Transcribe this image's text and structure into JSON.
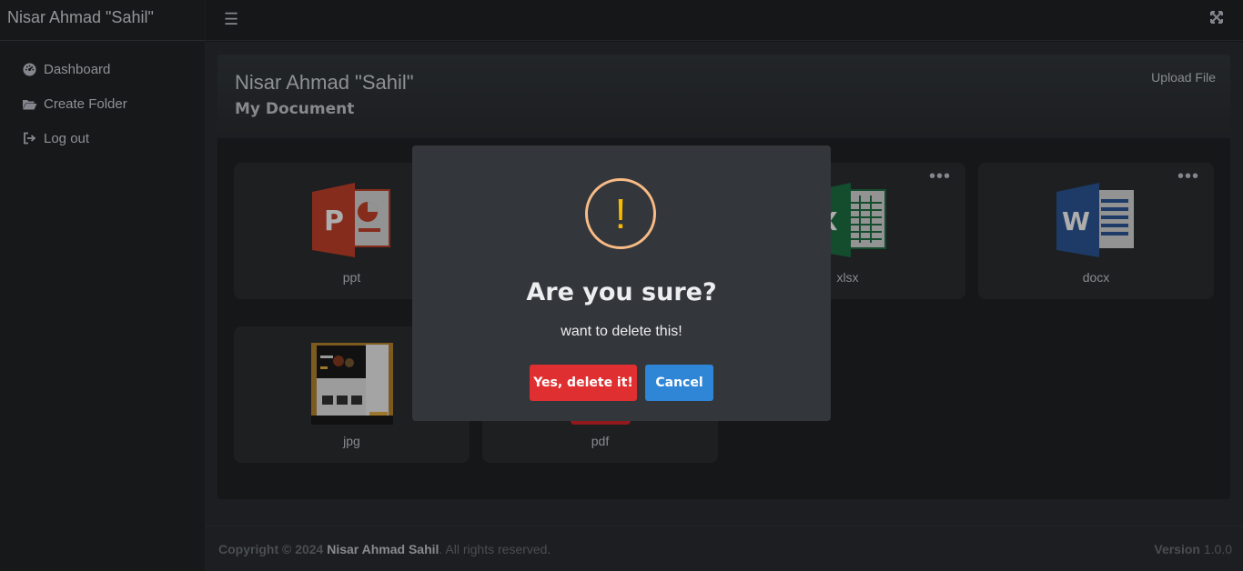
{
  "brand": "Nisar Ahmad \"Sahil\"",
  "sidebar": {
    "items": [
      {
        "label": "Dashboard",
        "icon": "dashboard-icon"
      },
      {
        "label": "Create Folder",
        "icon": "folder-open-icon"
      },
      {
        "label": "Log out",
        "icon": "logout-icon"
      }
    ]
  },
  "card": {
    "title": "Nisar Ahmad \"Sahil\"",
    "subtitle": "My Document",
    "upload_label": "Upload File"
  },
  "files": [
    {
      "label": "ppt",
      "icon": "powerpoint-icon"
    },
    {
      "label": "xlsx",
      "icon": "excel-icon"
    },
    {
      "label": "docx",
      "icon": "word-icon"
    },
    {
      "label": "jpg",
      "icon": "image-thumbnail"
    },
    {
      "label": "pdf",
      "icon": "pdf-icon"
    }
  ],
  "footer": {
    "copyright_prefix": "Copyright © 2024",
    "author": "Nisar Ahmad Sahil",
    "suffix": ". All rights reserved.",
    "version_label": "Version",
    "version": "1.0.0"
  },
  "modal": {
    "icon_glyph": "!",
    "title": "Are you sure?",
    "text": "want to delete this!",
    "confirm_label": "Yes, delete it!",
    "cancel_label": "Cancel"
  },
  "colors": {
    "confirm": "#e02f30",
    "cancel": "#2f86d6",
    "warning": "#f8bb86"
  }
}
